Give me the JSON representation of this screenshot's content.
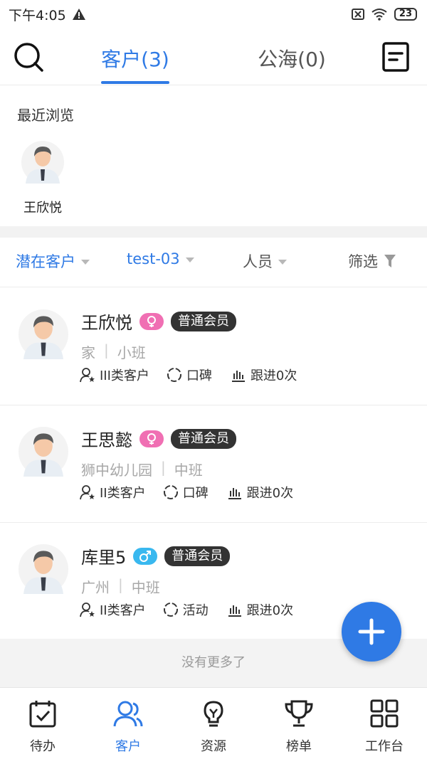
{
  "status_bar": {
    "time": "下午4:05",
    "battery": "23"
  },
  "header": {
    "tabs": [
      {
        "label": "客户(3)",
        "active": true
      },
      {
        "label": "公海(0)",
        "active": false
      }
    ],
    "icons": [
      "search-icon",
      "notes-icon"
    ]
  },
  "recent": {
    "title": "最近浏览",
    "items": [
      {
        "name": "王欣悦"
      }
    ]
  },
  "filters": {
    "type": "潜在客户",
    "user": "test-03",
    "staff": "人员",
    "screen": "筛选"
  },
  "customers": [
    {
      "name": "王欣悦",
      "gender": "female",
      "badge": "普通会员",
      "org": "家",
      "class": "小班",
      "category": "III类客户",
      "source": "口碑",
      "followups": "跟进0次"
    },
    {
      "name": "王思懿",
      "gender": "female",
      "badge": "普通会员",
      "org": "狮中幼儿园",
      "class": "中班",
      "category": "II类客户",
      "source": "口碑",
      "followups": "跟进0次"
    },
    {
      "name": "库里5",
      "gender": "male",
      "badge": "普通会员",
      "org": "广州",
      "class": "中班",
      "category": "II类客户",
      "source": "活动",
      "followups": "跟进0次"
    }
  ],
  "list_footer": "没有更多了",
  "colors": {
    "accent": "#2f7ae5",
    "female": "#f06fb3",
    "male": "#39b8ef",
    "badge": "#333333"
  },
  "bottom_nav": [
    {
      "label": "待办",
      "icon": "calendar-check-icon",
      "active": false
    },
    {
      "label": "客户",
      "icon": "customers-icon",
      "active": true
    },
    {
      "label": "资源",
      "icon": "lightbulb-icon",
      "active": false
    },
    {
      "label": "榜单",
      "icon": "trophy-icon",
      "active": false
    },
    {
      "label": "工作台",
      "icon": "grid-icon",
      "active": false
    }
  ]
}
